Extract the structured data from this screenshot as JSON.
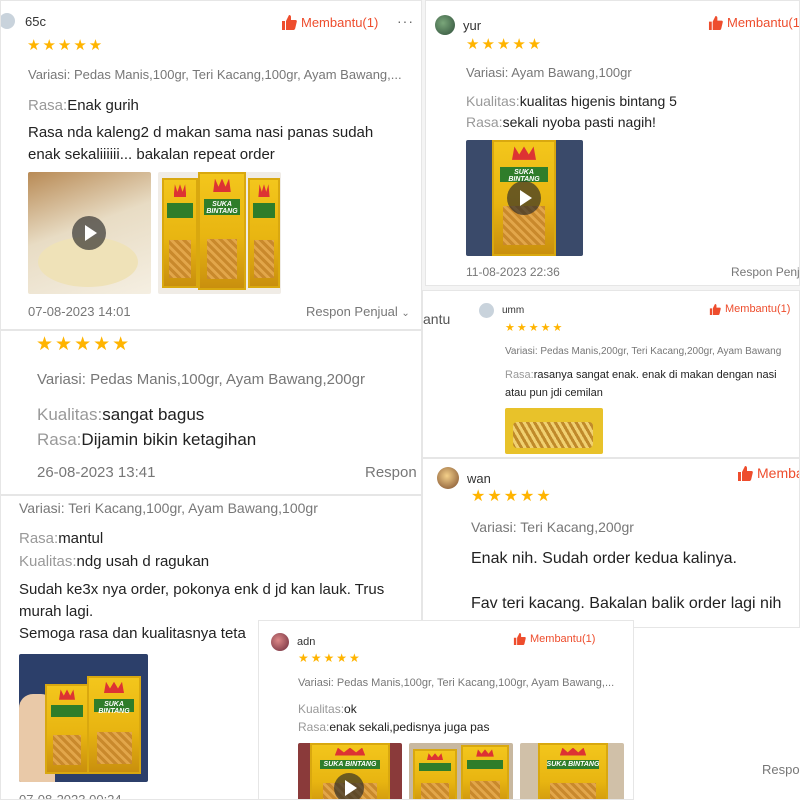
{
  "common": {
    "helpful_label": "Membantu(1)",
    "helpful_short": "Memba",
    "respon_label": "Respon Penjual",
    "respon_short": "Respon",
    "respon_short2": "Respon Penj",
    "respon_short3": "Respo",
    "stars": "★★★★★",
    "more": "···",
    "label_rasa": "Rasa:",
    "label_kualitas": "Kualitas:",
    "accent_color": "#ee4d2d",
    "star_color": "#ffb400"
  },
  "review1": {
    "username": "65c",
    "variant": "Variasi: Pedas Manis,100gr, Teri Kacang,100gr, Ayam Bawang,...",
    "rasa": "Enak gurih",
    "body_line1": "Rasa nda kaleng2 d makan sama nasi panas sudah",
    "body_line2": "enak sekaliiiiii... bakalan repeat order",
    "date": "07-08-2023 14:01"
  },
  "review2": {
    "username": "yur",
    "variant": "Variasi: Ayam Bawang,100gr",
    "kualitas": "kualitas higenis bintang 5",
    "rasa": "sekali nyoba pasti nagih!",
    "date": "11-08-2023 22:36"
  },
  "review3": {
    "variant": "Variasi: Pedas Manis,100gr, Ayam Bawang,200gr",
    "kualitas": "sangat bagus",
    "rasa": "Dijamin bikin ketagihan",
    "date": "26-08-2023 13:41"
  },
  "review4": {
    "username": "umm",
    "side_text": "antu",
    "variant": "Variasi: Pedas Manis,200gr, Teri Kacang,200gr, Ayam Bawang",
    "rasa": "rasanya sangat enak. enak di makan dengan nasi",
    "body_line2": "atau pun jdi cemilan"
  },
  "review5": {
    "variant": "Variasi: Teri Kacang,100gr, Ayam Bawang,100gr",
    "rasa": "mantul",
    "kualitas": "ndg usah d ragukan",
    "body_line1": "Sudah ke3x nya order, pokonya enk d jd kan lauk. Trus",
    "body_line2": "murah lagi.",
    "body_line3": "Semoga rasa dan kualitasnya teta",
    "date": "07-08-2023 00:24"
  },
  "review6": {
    "username": "wan",
    "variant": "Variasi: Teri Kacang,200gr",
    "body_line1": "Enak nih. Sudah order kedua kalinya.",
    "body_line2": "Fav teri kacang. Bakalan balik order lagi nih"
  },
  "review7": {
    "username": "adn",
    "variant": "Variasi: Pedas Manis,100gr, Teri Kacang,100gr, Ayam Bawang,...",
    "kualitas": "ok",
    "rasa": "enak sekali,pedisnya juga pas"
  },
  "product_brand": "SUKA BINTANG"
}
